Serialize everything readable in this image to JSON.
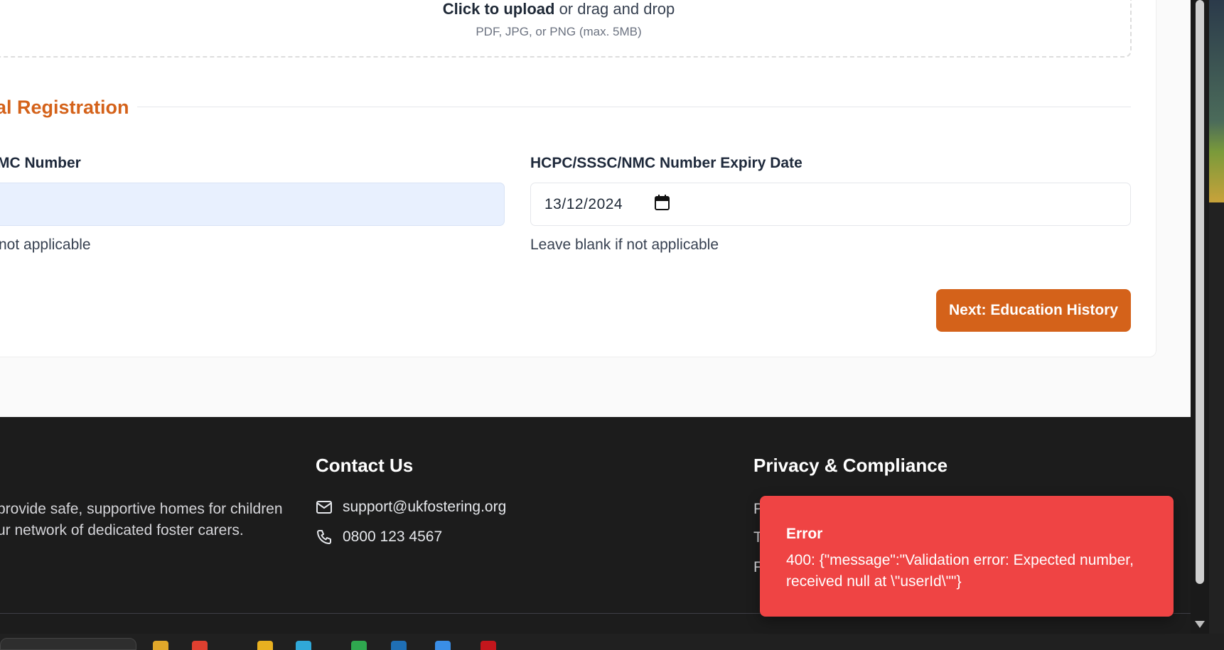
{
  "upload": {
    "main_bold": "Click to upload",
    "main_rest": " or drag and drop",
    "sub": "PDF, JPG, or PNG (max. 5MB)"
  },
  "section": {
    "title": "al Registration"
  },
  "fields": {
    "number_label": "MC Number",
    "number_value": "",
    "number_hint": "not applicable",
    "expiry_label": "HCPC/SSSC/NMC Number Expiry Date",
    "expiry_value": "13/12/2024",
    "expiry_hint": "Leave blank if not applicable"
  },
  "actions": {
    "next_label": "Next: Education History"
  },
  "footer": {
    "about_line1": "provide safe, supportive homes for children",
    "about_line2": "ur network of dedicated foster carers.",
    "contact_heading": "Contact Us",
    "contact_email": "support@ukfostering.org",
    "contact_phone": "0800 123 4567",
    "privacy_heading": "Privacy & Compliance",
    "privacy_link1": "P",
    "privacy_link2": "T",
    "privacy_link3": "F"
  },
  "toast": {
    "title": "Error",
    "message": "400: {\"message\":\"Validation error: Expected number, received null at \\\"userId\\\"\"}"
  },
  "colors": {
    "brand_orange": "#d4621a",
    "footer_bg": "#1c1c1c",
    "error_red": "#ef4444",
    "autofill_blue": "#e8f0fe"
  }
}
